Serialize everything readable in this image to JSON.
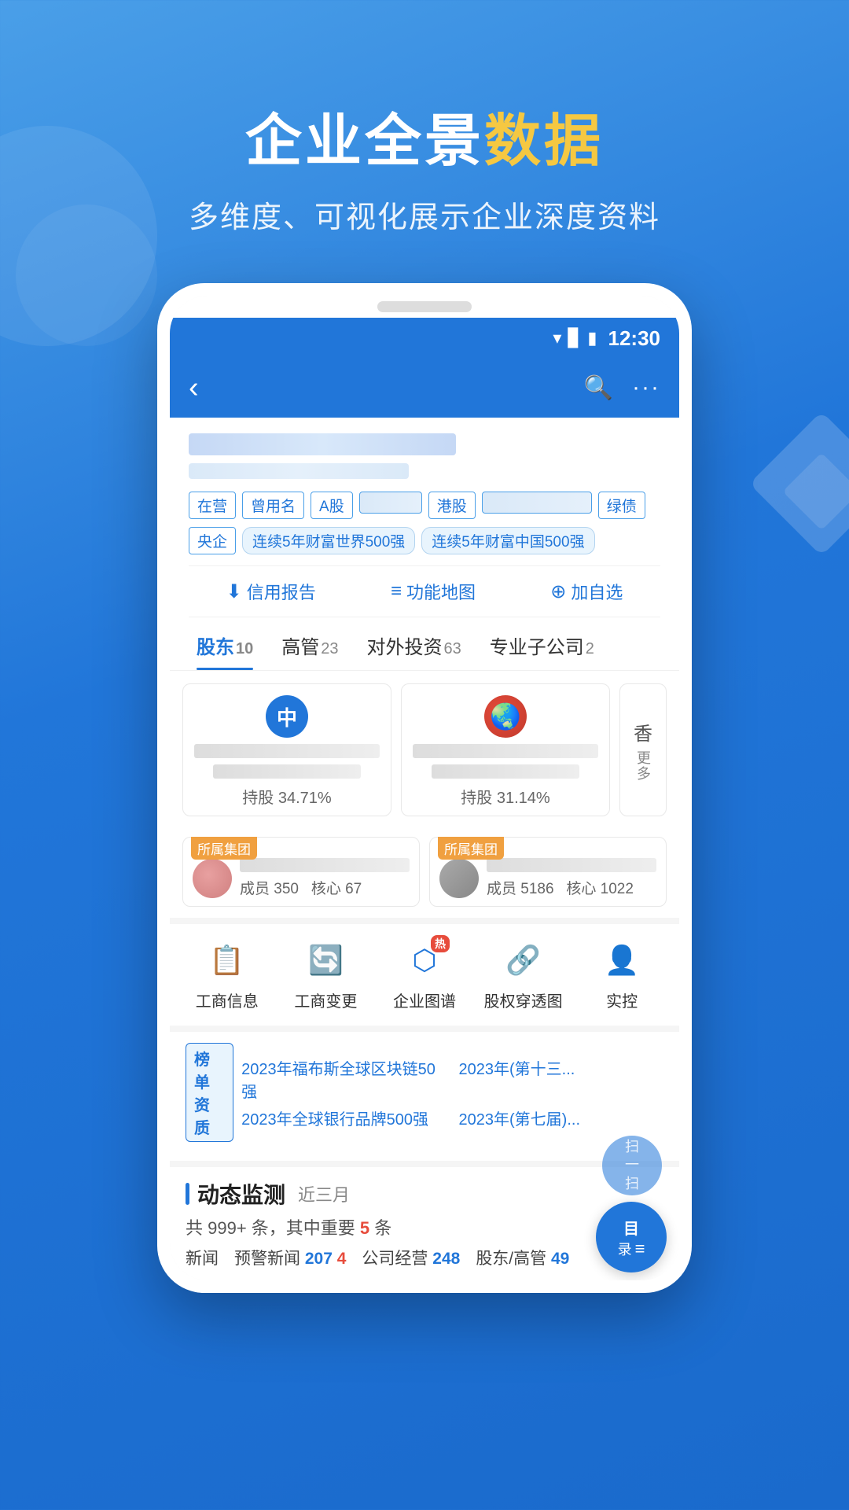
{
  "page": {
    "background": "#2176d9"
  },
  "top": {
    "title_white": "企业全景",
    "title_yellow": "数据",
    "subtitle": "多维度、可视化展示企业深度资料"
  },
  "status_bar": {
    "time": "12:30"
  },
  "header": {
    "back_icon": "‹",
    "search_icon": "○",
    "more_icon": "···"
  },
  "tags_row1": [
    "在营",
    "曾用名",
    "A股",
    "港股",
    "绿债"
  ],
  "tags_row2": [
    "央企",
    "连续5年财富世界500强",
    "连续5年财富中国500强"
  ],
  "actions": [
    {
      "icon": "↓",
      "label": "信用报告"
    },
    {
      "icon": "≡",
      "label": "功能地图"
    },
    {
      "icon": "+",
      "label": "加自选"
    }
  ],
  "tabs": [
    {
      "label": "股东",
      "count": "10",
      "active": true
    },
    {
      "label": "高管",
      "count": "23",
      "active": false
    },
    {
      "label": "对外投资",
      "count": "63",
      "active": false
    },
    {
      "label": "专业子公司",
      "count": "2",
      "active": false
    }
  ],
  "shareholders": [
    {
      "avatar_text": "中",
      "avatar_style": "blue",
      "share_pct": "持股 34.71%"
    },
    {
      "avatar_style": "red-globe",
      "share_pct": "持股 31.14%"
    }
  ],
  "more_label": "更多",
  "xiang_label": "香",
  "groups": [
    {
      "badge": "所属集团",
      "member": "成员 350",
      "core": "核心 67"
    },
    {
      "badge": "所属集团",
      "member": "成员 5186",
      "core": "核心 1022"
    }
  ],
  "features": [
    {
      "icon": "🗒",
      "label": "工商信息",
      "hot": false
    },
    {
      "icon": "🔄",
      "label": "工商变更",
      "hot": false
    },
    {
      "icon": "⬡",
      "label": "企业图谱",
      "hot": true
    },
    {
      "icon": "🔗",
      "label": "股权穿透图",
      "hot": false
    },
    {
      "icon": "👤",
      "label": "实控",
      "hot": false
    }
  ],
  "awards": {
    "title": "榜单\n资质",
    "items": [
      "2023年福布斯全球区块链50强",
      "2023年(第十三...",
      "2023年全球银行品牌500强",
      "2023年(第七届)..."
    ]
  },
  "monitor": {
    "title": "动态监测",
    "period": "近三月",
    "summary_prefix": "共 999+ 条，其中重要",
    "summary_em": "5",
    "summary_suffix": "条",
    "stats": [
      {
        "label": "新闻",
        "value": "",
        "extra": ""
      },
      {
        "label": "预警新闻",
        "value1": "207",
        "value2": "4"
      },
      {
        "label": "公司经营",
        "value": "248"
      },
      {
        "label": "股东/高管",
        "value": "49"
      }
    ]
  },
  "float_btn": {
    "label1": "目",
    "label2": "录",
    "icon": "≡"
  }
}
